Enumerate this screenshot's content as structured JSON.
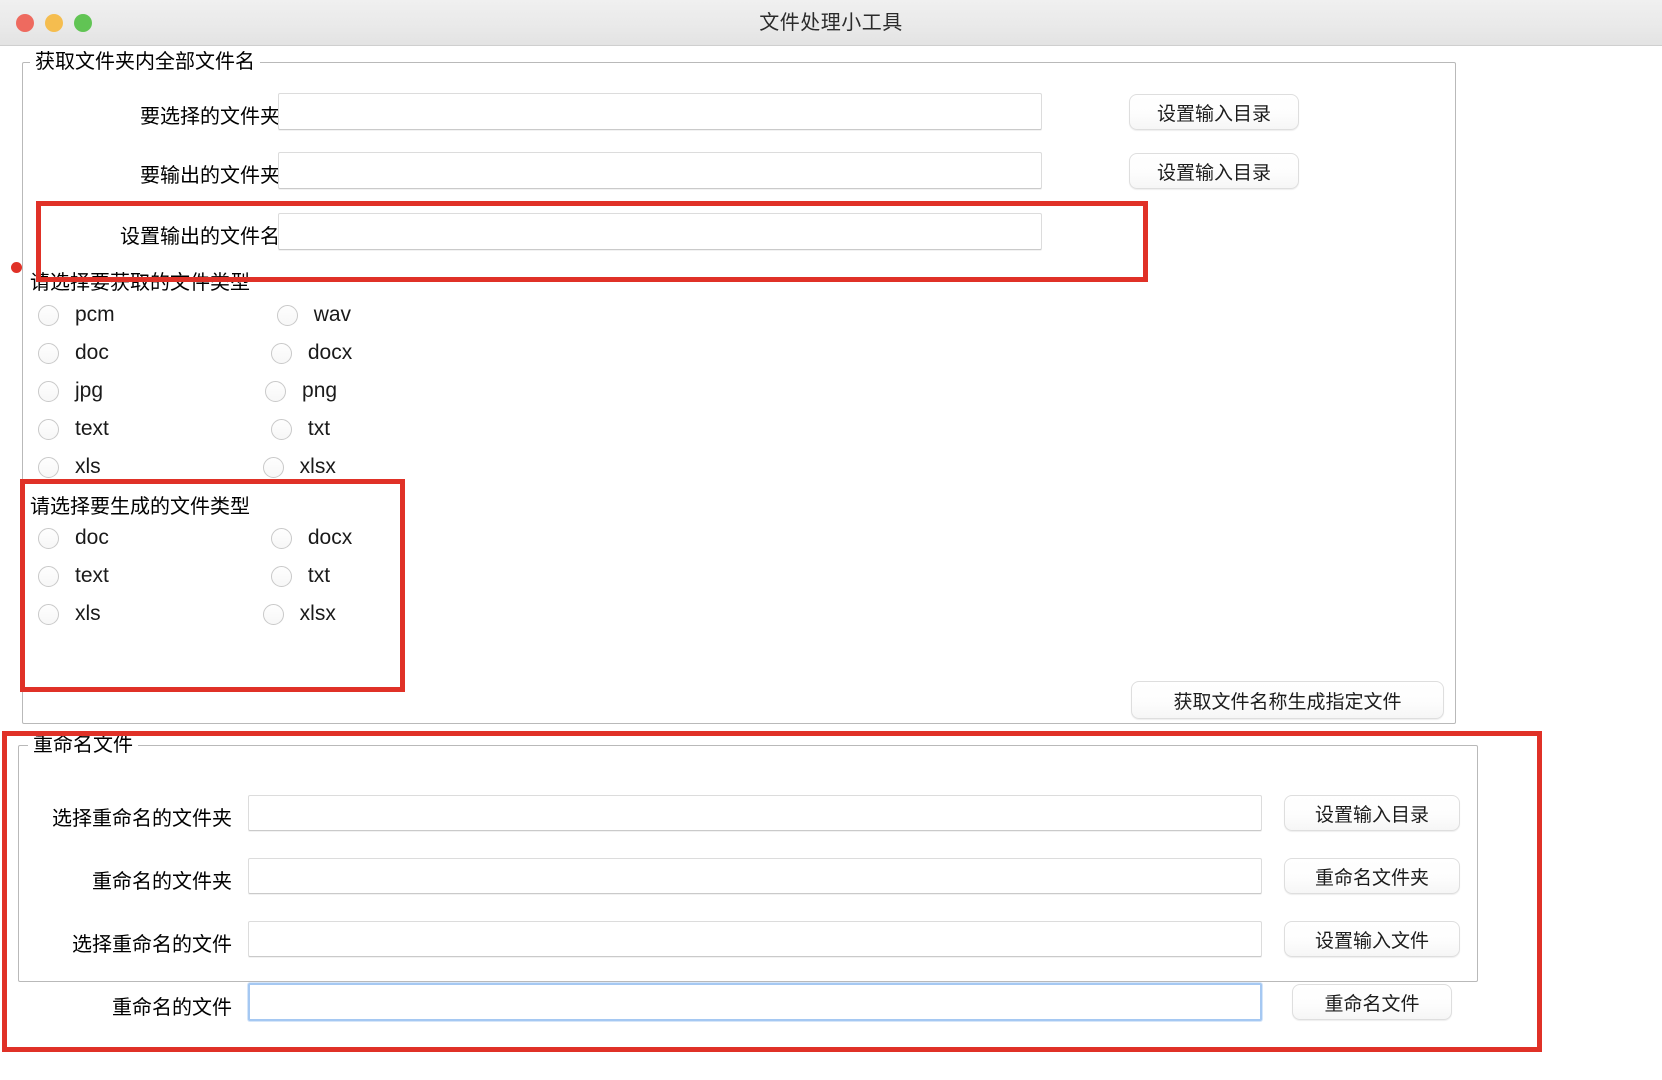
{
  "window": {
    "title": "文件处理小工具",
    "traffic_lights": [
      {
        "name": "close",
        "color": "#ee6a5f"
      },
      {
        "name": "minimize",
        "color": "#f5bd4f"
      },
      {
        "name": "zoom",
        "color": "#61c454"
      }
    ]
  },
  "extract_section": {
    "legend": "获取文件夹内全部文件名",
    "fields": [
      {
        "label": "要选择的文件夹",
        "value": "",
        "button": "设置输入目录"
      },
      {
        "label": "要输出的文件夹",
        "value": "",
        "button": "设置输入目录"
      },
      {
        "label": "设置输出的文件名",
        "value": "",
        "button": ""
      }
    ],
    "source_types": {
      "title": "请选择要获取的文件类型",
      "options": [
        {
          "left": "pcm",
          "right": "wav"
        },
        {
          "left": "doc",
          "right": "docx"
        },
        {
          "left": "jpg",
          "right": "png"
        },
        {
          "left": "text",
          "right": "txt"
        },
        {
          "left": "xls",
          "right": "xlsx"
        }
      ],
      "selected": ""
    },
    "target_types": {
      "title": "请选择要生成的文件类型",
      "options": [
        {
          "left": "doc",
          "right": "docx"
        },
        {
          "left": "text",
          "right": "txt"
        },
        {
          "left": "xls",
          "right": "xlsx"
        }
      ],
      "selected": ""
    },
    "action_button": "获取文件名称生成指定文件"
  },
  "rename_section": {
    "legend": "重命名文件",
    "rows": [
      {
        "label": "选择重命名的文件夹",
        "value": "",
        "placeholder": "",
        "button": "设置输入目录",
        "focused": false
      },
      {
        "label": "重命名的文件夹",
        "value": "",
        "placeholder": "",
        "button": "重命名文件夹",
        "focused": false
      },
      {
        "label": "选择重命名的文件",
        "value": "",
        "placeholder": "",
        "button": "设置输入文件",
        "focused": false
      },
      {
        "label": "重命名的文件",
        "value": "",
        "placeholder": "",
        "button": "重命名文件",
        "focused": true
      }
    ]
  },
  "annotations": {
    "color": "#e03127",
    "boxes": [
      {
        "name": "output-filename-highlight"
      },
      {
        "name": "target-filetype-highlight"
      },
      {
        "name": "rename-section-highlight"
      }
    ],
    "dot": {
      "name": "output-filename-marker"
    }
  }
}
